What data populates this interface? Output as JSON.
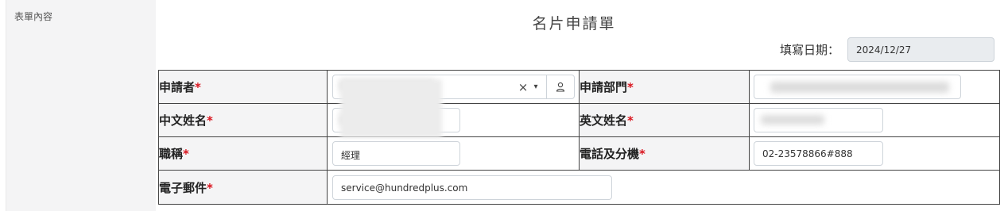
{
  "sidebar": {
    "label": "表單內容"
  },
  "form": {
    "title": "名片申請單",
    "date_label": "填寫日期：",
    "date_value": "2024/12/27",
    "rows": [
      {
        "left_label": "申請者",
        "left_value": "",
        "right_label": "申請部門",
        "right_value": ""
      },
      {
        "left_label": "中文姓名",
        "left_value": "",
        "right_label": "英文姓名",
        "right_value": ""
      },
      {
        "left_label": "職稱",
        "left_value": "經理",
        "right_label": "電話及分機",
        "right_value": "02-23578866#888"
      },
      {
        "left_label": "電子郵件",
        "left_value": "service@hundredplus.com"
      }
    ],
    "required_marker": "*",
    "clear_glyph": "×",
    "chevron_glyph": "⌄"
  }
}
